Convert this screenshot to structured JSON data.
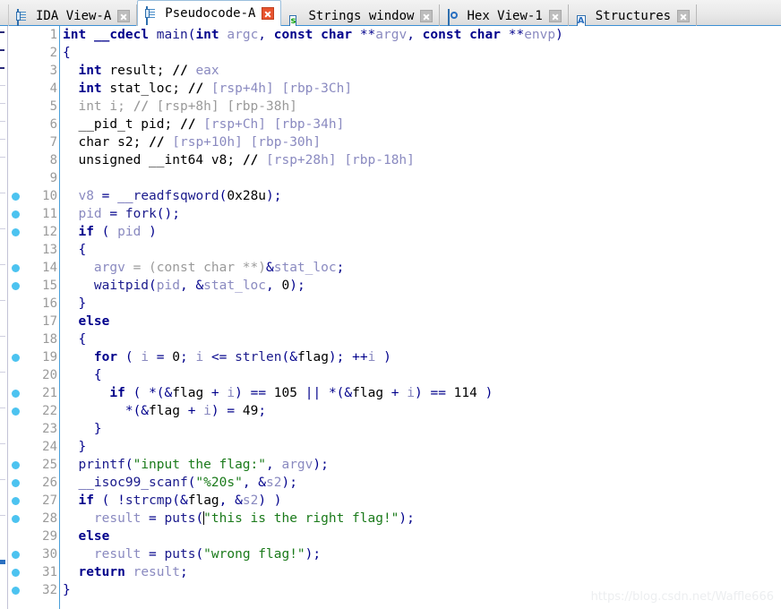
{
  "window": {
    "app": "IDA Pro",
    "view": "Pseudocode-A"
  },
  "tabs": [
    {
      "label": "IDA View-A",
      "icon": "document-icon",
      "active": false,
      "close_icon": "close-icon"
    },
    {
      "label": "Pseudocode-A",
      "icon": "document-icon",
      "active": true,
      "close_icon": "close-icon-active"
    },
    {
      "label": "Strings window",
      "icon": "strings-icon",
      "active": false,
      "close_icon": "close-icon"
    },
    {
      "label": "Hex View-1",
      "icon": "hex-view-icon",
      "active": false,
      "close_icon": "close-icon"
    },
    {
      "label": "Structures",
      "icon": "structures-icon",
      "active": false,
      "close_icon": "close-icon"
    }
  ],
  "editor": {
    "first_line": 1,
    "last_line": 32,
    "cursor_line": 28,
    "line_numbers": [
      1,
      2,
      3,
      4,
      5,
      6,
      7,
      8,
      9,
      10,
      11,
      12,
      13,
      14,
      15,
      16,
      17,
      18,
      19,
      20,
      21,
      22,
      23,
      24,
      25,
      26,
      27,
      28,
      29,
      30,
      31,
      32
    ],
    "breakpoint_lines": [
      10,
      11,
      12,
      14,
      15,
      19,
      21,
      22,
      25,
      26,
      27,
      28,
      30,
      31,
      32
    ],
    "lines": [
      "int __cdecl main(int argc, const char **argv, const char **envp)",
      "{",
      "  int result; // eax",
      "  int stat_loc; // [rsp+4h] [rbp-3Ch]",
      "  int i; // [rsp+8h] [rbp-38h]",
      "  __pid_t pid; // [rsp+Ch] [rbp-34h]",
      "  char s2; // [rsp+10h] [rbp-30h]",
      "  unsigned __int64 v8; // [rsp+28h] [rbp-18h]",
      "",
      "  v8 = __readfsqword(0x28u);",
      "  pid = fork();",
      "  if ( pid )",
      "  {",
      "    argv = (const char **)&stat_loc;",
      "    waitpid(pid, &stat_loc, 0);",
      "  }",
      "  else",
      "  {",
      "    for ( i = 0; i <= strlen(&flag); ++i )",
      "    {",
      "      if ( *(&flag + i) == 105 || *(&flag + i) == 114 )",
      "        *(&flag + i) = 49;",
      "    }",
      "  }",
      "  printf(\"input the flag:\", argv);",
      "  __isoc99_scanf(\"%20s\", &s2);",
      "  if ( !strcmp(&flag, &s2) )",
      "    result = puts(\"this is the right flag!\");",
      "  else",
      "    result = puts(\"wrong flag!\");",
      "  return result;",
      "}"
    ],
    "strings": [
      "input the flag:",
      "%20s",
      "this is the right flag!",
      "wrong flag!"
    ],
    "constants": [
      "0x28u",
      "0",
      "105",
      "114",
      "49"
    ],
    "variables": [
      "result",
      "stat_loc",
      "i",
      "pid",
      "s2",
      "v8",
      "argv",
      "argc",
      "envp",
      "flag"
    ],
    "functions": [
      "main",
      "__readfsqword",
      "fork",
      "waitpid",
      "strlen",
      "printf",
      "__isoc99_scanf",
      "strcmp",
      "puts"
    ],
    "comments": [
      "// eax",
      "// [rsp+4h] [rbp-3Ch]",
      "// [rsp+8h] [rbp-38h]",
      "// [rsp+Ch] [rbp-34h]",
      "// [rsp+10h] [rbp-30h]",
      "// [rsp+28h] [rbp-18h]"
    ]
  },
  "watermark": "https://blog.csdn.net/Waffle666",
  "colors": {
    "keyword": "#00008B",
    "string": "#1a7a1a",
    "variable": "#8a8ac0",
    "comment_marker": "#000000",
    "comment_text": "#8a8ac0",
    "line_number": "#9a9a9a",
    "breakpoint": "#4cc3f0",
    "tab_accent": "#3c8fd4",
    "close_active": "#e8542f"
  }
}
